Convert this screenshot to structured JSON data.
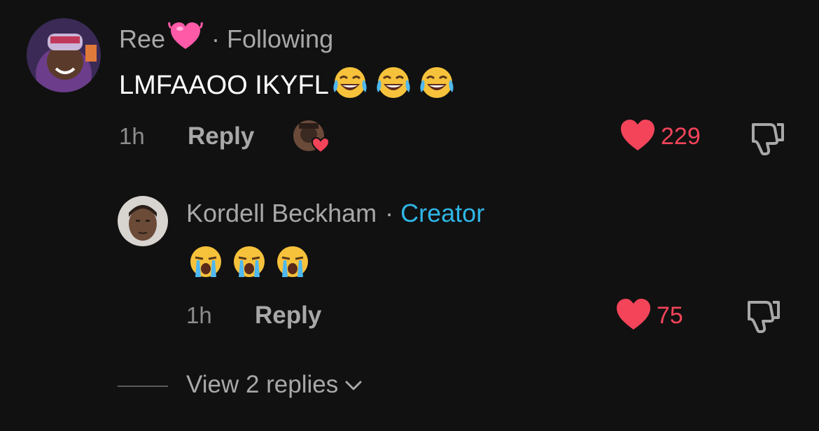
{
  "comment": {
    "username": "Ree",
    "username_emoji": "heart-emoji",
    "separator": "·",
    "status": "Following",
    "text": "LMFAAOO IKYFL",
    "emojis": [
      "tears-of-joy-emoji",
      "tears-of-joy-emoji",
      "tears-of-joy-emoji"
    ],
    "time": "1h",
    "reply_label": "Reply",
    "likes": "229"
  },
  "reply": {
    "username": "Kordell Beckham",
    "separator": "·",
    "badge": "Creator",
    "emojis": [
      "loudly-crying-emoji",
      "loudly-crying-emoji",
      "loudly-crying-emoji"
    ],
    "time": "1h",
    "reply_label": "Reply",
    "likes": "75"
  },
  "view_replies": {
    "label": "View 2 replies"
  },
  "colors": {
    "background": "#111111",
    "like": "#f3445a",
    "creator": "#2fb6e6",
    "muted": "#a8a8a8"
  }
}
